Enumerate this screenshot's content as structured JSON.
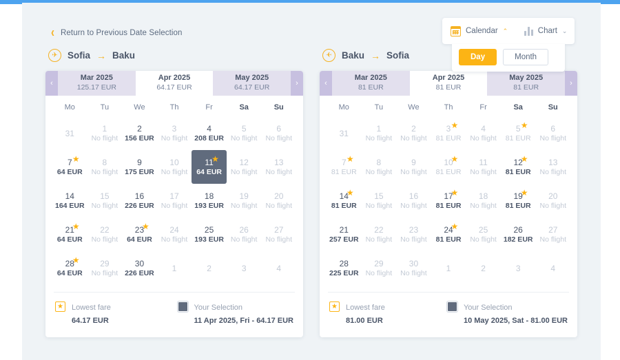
{
  "nav": {
    "return_link": "Return to Previous Date Selection",
    "back_chevron_icon": "chevron-left-icon"
  },
  "view_switch": {
    "calendar_label": "Calendar",
    "calendar_icon": "calendar-icon",
    "calendar_caret": "⌃",
    "chart_label": "Chart",
    "chart_icon": "bar-chart-icon",
    "chart_caret": "⌄",
    "day_label": "Day",
    "month_label": "Month",
    "active_granularity": "Day",
    "accent_color": "#fcb415"
  },
  "weekdays": [
    "Mo",
    "Tu",
    "We",
    "Th",
    "Fr",
    "Sa",
    "Su"
  ],
  "panes": [
    {
      "origin": "Sofia",
      "destination": "Baku",
      "arrow": "→",
      "direction_icon": "plane-right-icon",
      "prev_icon": "‹",
      "next_icon": "›",
      "months": [
        {
          "name": "Mar 2025",
          "price": "125.17 EUR",
          "active": false
        },
        {
          "name": "Apr 2025",
          "price": "64.17 EUR",
          "active": true
        },
        {
          "name": "May 2025",
          "price": "64.17 EUR",
          "active": false
        }
      ],
      "weeks": [
        [
          {
            "day": "31",
            "price": "",
            "state": "outside"
          },
          {
            "day": "1",
            "price": "No flight",
            "state": "none"
          },
          {
            "day": "2",
            "price": "156 EUR",
            "state": "avail"
          },
          {
            "day": "3",
            "price": "No flight",
            "state": "none"
          },
          {
            "day": "4",
            "price": "208 EUR",
            "state": "avail"
          },
          {
            "day": "5",
            "price": "No flight",
            "state": "none"
          },
          {
            "day": "6",
            "price": "No flight",
            "state": "none"
          }
        ],
        [
          {
            "day": "7",
            "price": "64 EUR",
            "state": "avail",
            "star": true
          },
          {
            "day": "8",
            "price": "No flight",
            "state": "none"
          },
          {
            "day": "9",
            "price": "175 EUR",
            "state": "avail"
          },
          {
            "day": "10",
            "price": "No flight",
            "state": "none"
          },
          {
            "day": "11",
            "price": "64 EUR",
            "state": "selected",
            "star": true
          },
          {
            "day": "12",
            "price": "No flight",
            "state": "none"
          },
          {
            "day": "13",
            "price": "No flight",
            "state": "none"
          }
        ],
        [
          {
            "day": "14",
            "price": "164 EUR",
            "state": "avail"
          },
          {
            "day": "15",
            "price": "No flight",
            "state": "none"
          },
          {
            "day": "16",
            "price": "226 EUR",
            "state": "avail"
          },
          {
            "day": "17",
            "price": "No flight",
            "state": "none"
          },
          {
            "day": "18",
            "price": "193 EUR",
            "state": "avail"
          },
          {
            "day": "19",
            "price": "No flight",
            "state": "none"
          },
          {
            "day": "20",
            "price": "No flight",
            "state": "none"
          }
        ],
        [
          {
            "day": "21",
            "price": "64 EUR",
            "state": "avail",
            "star": true
          },
          {
            "day": "22",
            "price": "No flight",
            "state": "none"
          },
          {
            "day": "23",
            "price": "64 EUR",
            "state": "avail",
            "star": true
          },
          {
            "day": "24",
            "price": "No flight",
            "state": "none"
          },
          {
            "day": "25",
            "price": "193 EUR",
            "state": "avail"
          },
          {
            "day": "26",
            "price": "No flight",
            "state": "none"
          },
          {
            "day": "27",
            "price": "No flight",
            "state": "none"
          }
        ],
        [
          {
            "day": "28",
            "price": "64 EUR",
            "state": "avail",
            "star": true
          },
          {
            "day": "29",
            "price": "No flight",
            "state": "none"
          },
          {
            "day": "30",
            "price": "226 EUR",
            "state": "avail"
          },
          {
            "day": "1",
            "price": "",
            "state": "outside"
          },
          {
            "day": "2",
            "price": "",
            "state": "outside"
          },
          {
            "day": "3",
            "price": "",
            "state": "outside"
          },
          {
            "day": "4",
            "price": "",
            "state": "outside"
          }
        ]
      ],
      "legend": {
        "lowest_title": "Lowest fare",
        "lowest_value": "64.17 EUR",
        "selection_title": "Your Selection",
        "selection_value": "11 Apr 2025, Fri - 64.17 EUR",
        "star_icon": "star-icon",
        "selection_swatch_icon": "selected-square-icon"
      }
    },
    {
      "origin": "Baku",
      "destination": "Sofia",
      "arrow": "→",
      "direction_icon": "plane-left-icon",
      "prev_icon": "‹",
      "next_icon": "›",
      "months": [
        {
          "name": "Mar 2025",
          "price": "81 EUR",
          "active": false
        },
        {
          "name": "Apr 2025",
          "price": "81 EUR",
          "active": true
        },
        {
          "name": "May 2025",
          "price": "81 EUR",
          "active": false
        }
      ],
      "weeks": [
        [
          {
            "day": "31",
            "price": "",
            "state": "outside"
          },
          {
            "day": "1",
            "price": "No flight",
            "state": "none"
          },
          {
            "day": "2",
            "price": "No flight",
            "state": "none"
          },
          {
            "day": "3",
            "price": "81 EUR",
            "state": "muted",
            "star": true
          },
          {
            "day": "4",
            "price": "No flight",
            "state": "none"
          },
          {
            "day": "5",
            "price": "81 EUR",
            "state": "muted",
            "star": true
          },
          {
            "day": "6",
            "price": "No flight",
            "state": "none"
          }
        ],
        [
          {
            "day": "7",
            "price": "81 EUR",
            "state": "muted",
            "star": true
          },
          {
            "day": "8",
            "price": "No flight",
            "state": "none"
          },
          {
            "day": "9",
            "price": "No flight",
            "state": "none"
          },
          {
            "day": "10",
            "price": "81 EUR",
            "state": "muted",
            "star": true
          },
          {
            "day": "11",
            "price": "No flight",
            "state": "none"
          },
          {
            "day": "12",
            "price": "81 EUR",
            "state": "avail",
            "star": true
          },
          {
            "day": "13",
            "price": "No flight",
            "state": "none"
          }
        ],
        [
          {
            "day": "14",
            "price": "81 EUR",
            "state": "avail",
            "star": true
          },
          {
            "day": "15",
            "price": "No flight",
            "state": "none"
          },
          {
            "day": "16",
            "price": "No flight",
            "state": "none"
          },
          {
            "day": "17",
            "price": "81 EUR",
            "state": "avail",
            "star": true
          },
          {
            "day": "18",
            "price": "No flight",
            "state": "none"
          },
          {
            "day": "19",
            "price": "81 EUR",
            "state": "avail",
            "star": true
          },
          {
            "day": "20",
            "price": "No flight",
            "state": "none"
          }
        ],
        [
          {
            "day": "21",
            "price": "257 EUR",
            "state": "avail"
          },
          {
            "day": "22",
            "price": "No flight",
            "state": "none"
          },
          {
            "day": "23",
            "price": "No flight",
            "state": "none"
          },
          {
            "day": "24",
            "price": "81 EUR",
            "state": "avail",
            "star": true
          },
          {
            "day": "25",
            "price": "No flight",
            "state": "none"
          },
          {
            "day": "26",
            "price": "182 EUR",
            "state": "avail"
          },
          {
            "day": "27",
            "price": "No flight",
            "state": "none"
          }
        ],
        [
          {
            "day": "28",
            "price": "225 EUR",
            "state": "avail"
          },
          {
            "day": "29",
            "price": "No flight",
            "state": "none"
          },
          {
            "day": "30",
            "price": "No flight",
            "state": "none"
          },
          {
            "day": "1",
            "price": "",
            "state": "outside"
          },
          {
            "day": "2",
            "price": "",
            "state": "outside"
          },
          {
            "day": "3",
            "price": "",
            "state": "outside"
          },
          {
            "day": "4",
            "price": "",
            "state": "outside"
          }
        ]
      ],
      "legend": {
        "lowest_title": "Lowest fare",
        "lowest_value": "81.00 EUR",
        "selection_title": "Your Selection",
        "selection_value": "10 May 2025, Sat - 81.00 EUR",
        "star_icon": "star-icon",
        "selection_swatch_icon": "selected-square-icon"
      }
    }
  ]
}
